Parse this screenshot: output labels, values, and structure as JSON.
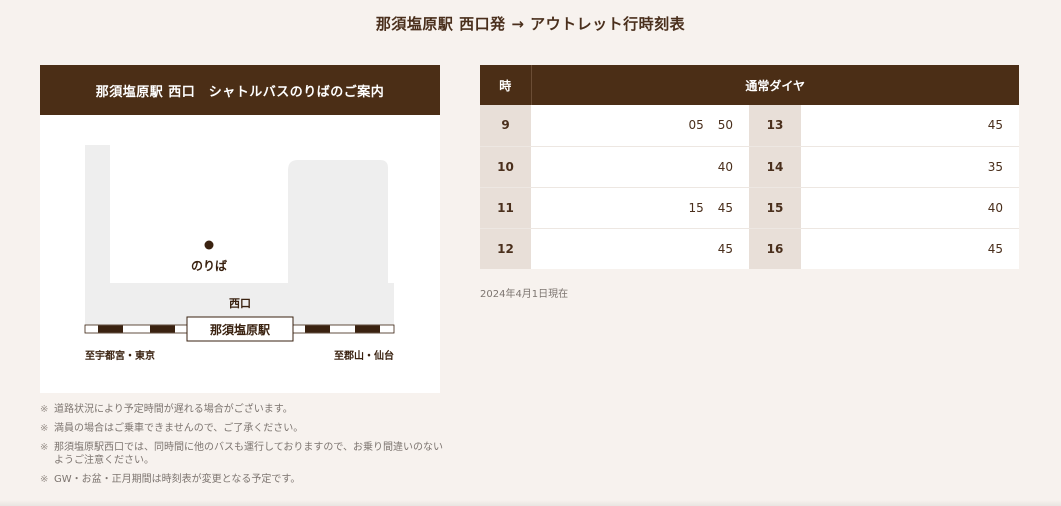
{
  "page": {
    "title": "那須塩原駅 西口発 → アウトレット行時刻表"
  },
  "map": {
    "header": "那須塩原駅 西口　シャトルバスのりばのご案内",
    "stop_label": "のりば",
    "exit_label": "西口",
    "station_label": "那須塩原駅",
    "left_direction": "至宇都宮・東京",
    "right_direction": "至郡山・仙台"
  },
  "timetable": {
    "hour_header": "時",
    "schedule_header": "通常ダイヤ",
    "rows": [
      {
        "left_hour": "9",
        "left_minutes": [
          "05",
          "50"
        ],
        "right_hour": "13",
        "right_minutes": [
          "45"
        ]
      },
      {
        "left_hour": "10",
        "left_minutes": [
          "40"
        ],
        "right_hour": "14",
        "right_minutes": [
          "35"
        ]
      },
      {
        "left_hour": "11",
        "left_minutes": [
          "15",
          "45"
        ],
        "right_hour": "15",
        "right_minutes": [
          "40"
        ]
      },
      {
        "left_hour": "12",
        "left_minutes": [
          "45"
        ],
        "right_hour": "16",
        "right_minutes": [
          "45"
        ]
      }
    ],
    "as_of": "2024年4月1日現在"
  },
  "notes": {
    "mark": "※",
    "items": [
      "道路状況により予定時間が遅れる場合がございます。",
      "満員の場合はご乗車できませんので、ご了承ください。",
      "那須塩原駅西口では、同時間に他のバスも運行しておりますので、お乗り間違いのないようご注意ください。",
      "GW・お盆・正月期間は時刻表が変更となる予定です。"
    ]
  },
  "colors": {
    "brand_brown": "#4b2e16",
    "background": "#f7f2ee",
    "hour_cell": "#e8dfd8",
    "map_ground": "#eeeeee"
  }
}
